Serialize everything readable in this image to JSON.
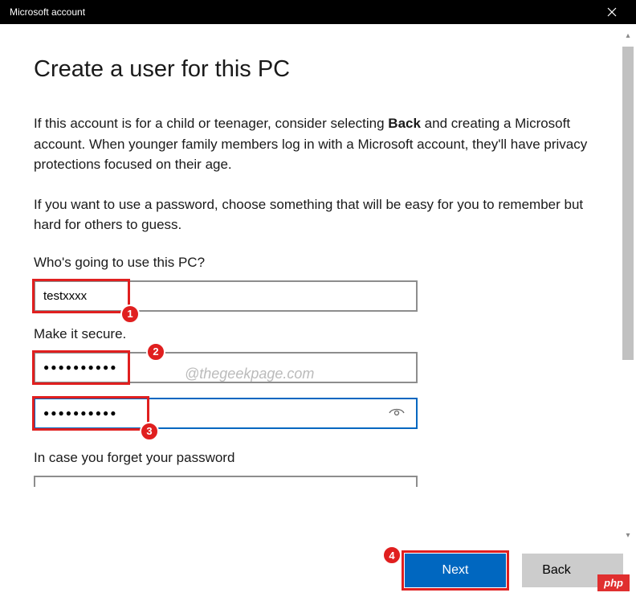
{
  "window": {
    "title": "Microsoft account"
  },
  "page": {
    "heading": "Create a user for this PC",
    "para1_pre": "If this account is for a child or teenager, consider selecting ",
    "para1_bold": "Back",
    "para1_post": " and creating a Microsoft account. When younger family members log in with a Microsoft account, they'll have privacy protections focused on their age.",
    "para2": "If you want to use a password, choose something that will be easy for you to remember but hard for others to guess.",
    "section_user_label": "Who's going to use this PC?",
    "section_secure_label": "Make it secure.",
    "section_forgot_label": "In case you forget your password"
  },
  "fields": {
    "username": "testxxxx",
    "password": "●●●●●●●●●●",
    "confirm_password": "●●●●●●●●●●"
  },
  "annotations": {
    "b1": "1",
    "b2": "2",
    "b3": "3",
    "b4": "4"
  },
  "buttons": {
    "next": "Next",
    "back": "Back"
  },
  "watermark": "@thegeekpage.com",
  "overlay": {
    "php": "php"
  }
}
